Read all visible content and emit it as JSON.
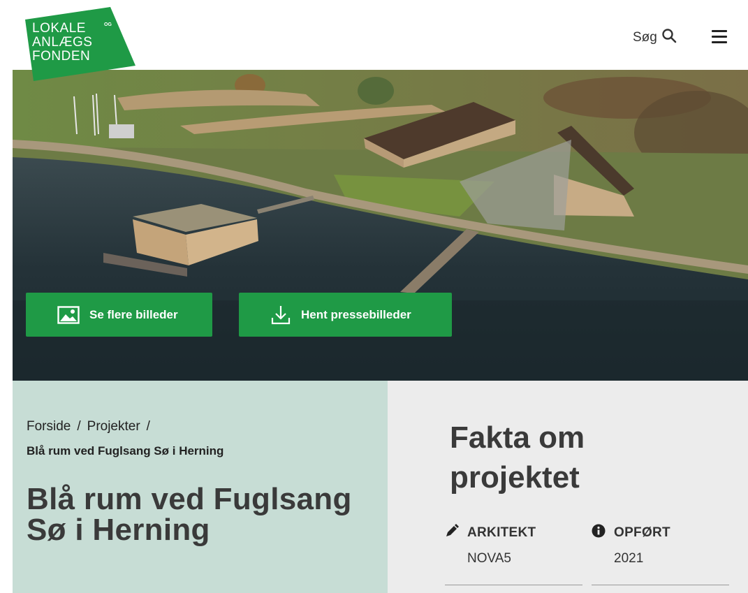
{
  "header": {
    "logo": {
      "line1": "LOKALE",
      "og": "OG",
      "line2": "ANLÆGS",
      "line3": "FONDEN"
    },
    "search_label": "Søg",
    "search_icon": "search-icon",
    "menu_icon": "hamburger-menu-icon"
  },
  "hero": {
    "buttons": [
      {
        "label": "Se flere billeder",
        "icon": "image-icon"
      },
      {
        "label": "Hent pressebilleder",
        "icon": "download-icon"
      }
    ]
  },
  "breadcrumb": {
    "items": [
      "Forside",
      "Projekter"
    ],
    "separator": "/",
    "current": "Blå rum ved Fuglsang Sø i Herning"
  },
  "page": {
    "title": "Blå rum ved Fuglsang Sø i Herning"
  },
  "facts": {
    "title": "Fakta om projektet",
    "items": [
      {
        "label": "ARKITEKT",
        "value": "NOVA5",
        "icon": "pencil-icon"
      },
      {
        "label": "OPFØRT",
        "value": "2021",
        "icon": "info-icon"
      }
    ]
  },
  "colors": {
    "brand_green": "#1f9a46",
    "left_panel": "#c7ddd5",
    "right_panel": "#ececec"
  }
}
